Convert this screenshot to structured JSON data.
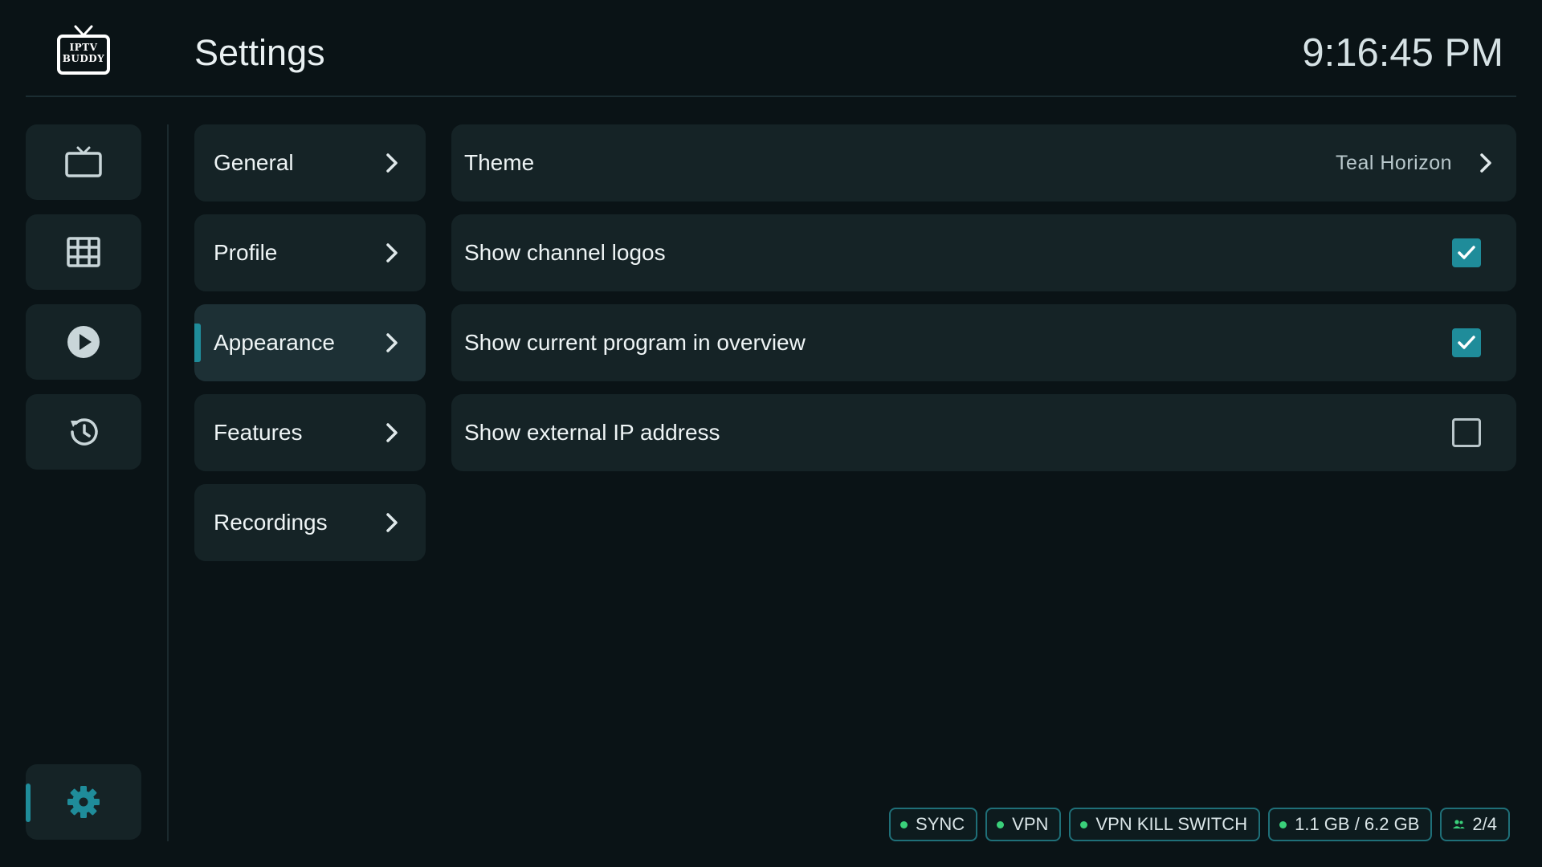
{
  "header": {
    "logo_text_line1": "IPTV",
    "logo_text_line2": "BUDDY",
    "title": "Settings",
    "clock": "9:16:45 PM"
  },
  "rail": {
    "items": [
      {
        "icon": "tv-icon"
      },
      {
        "icon": "grid-guide-icon"
      },
      {
        "icon": "play-circle-icon"
      },
      {
        "icon": "history-icon"
      },
      {
        "icon": "gear-icon",
        "active": true
      }
    ]
  },
  "categories": [
    {
      "label": "General"
    },
    {
      "label": "Profile"
    },
    {
      "label": "Appearance",
      "active": true
    },
    {
      "label": "Features"
    },
    {
      "label": "Recordings"
    }
  ],
  "settings": {
    "theme": {
      "label": "Theme",
      "value": "Teal Horizon"
    },
    "channel_logos": {
      "label": "Show channel logos",
      "checked": true
    },
    "current_program": {
      "label": "Show current program in overview",
      "checked": true
    },
    "external_ip": {
      "label": "Show external IP address",
      "checked": false
    }
  },
  "status": {
    "sync": "SYNC",
    "vpn": "VPN",
    "vpn_kill_switch": "VPN KILL SWITCH",
    "storage": "1.1 GB / 6.2 GB",
    "users": "2/4"
  },
  "colors": {
    "background": "#0a1316",
    "card": "#152326",
    "accent": "#1f8c9a",
    "status_dot": "#3ad07a"
  }
}
